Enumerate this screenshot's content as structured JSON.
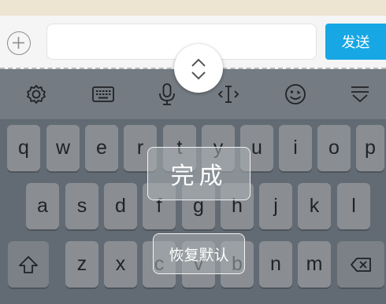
{
  "chat_input": {
    "value": "",
    "send_label": "发送"
  },
  "toolbar": {
    "items": [
      "gear-icon",
      "keyboard-icon",
      "microphone-icon",
      "text-cursor-icon",
      "emoji-icon",
      "collapse-keyboard-icon"
    ]
  },
  "keyboard": {
    "row1": [
      "q",
      "w",
      "e",
      "r",
      "t",
      "y",
      "u",
      "i",
      "o",
      "p"
    ],
    "row2": [
      "a",
      "s",
      "d",
      "f",
      "g",
      "h",
      "j",
      "k",
      "l"
    ],
    "row3": [
      "z",
      "x",
      "c",
      "v",
      "b",
      "n",
      "m"
    ]
  },
  "overlay": {
    "done_label": "完成",
    "reset_label": "恢复默认"
  },
  "colors": {
    "send_button": "#17a7e5",
    "keyboard_background": "#626b73",
    "key": "#8a8e93"
  }
}
